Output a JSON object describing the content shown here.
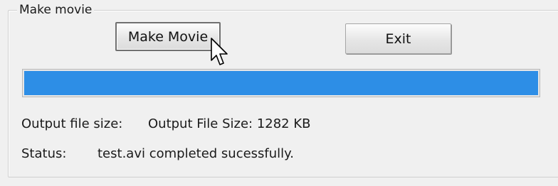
{
  "group": {
    "title": "Make movie"
  },
  "buttons": {
    "make_movie_label": "Make Movie",
    "exit_label": "Exit"
  },
  "progress": {
    "percent": 100,
    "fill_color": "#2d8ee6"
  },
  "output_size": {
    "label": "Output file size:",
    "value": "Output File Size:  1282 KB"
  },
  "status": {
    "label": "Status:",
    "value": "test.avi completed sucessfully."
  },
  "cursor": {
    "icon": "mouse-pointer-icon"
  }
}
